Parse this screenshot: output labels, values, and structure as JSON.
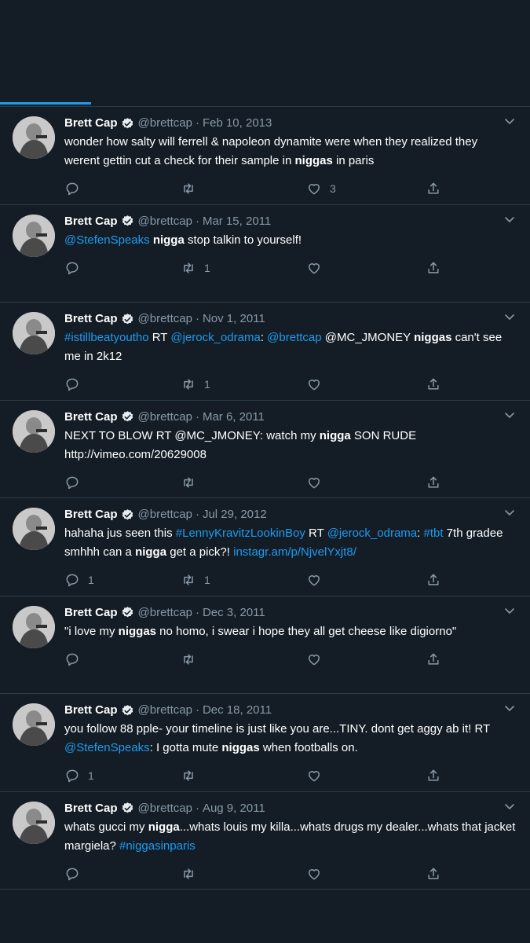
{
  "accent": "#1d9bf0",
  "background": "#141d26",
  "tweets": [
    {
      "name": "Brett Cap",
      "handle": "@brettcap",
      "date": "Feb 10, 2013",
      "parts": [
        {
          "t": "wonder how salty will ferrell & napoleon dynamite were when they realized they werent gettin cut a check for their sample in ",
          "s": "n"
        },
        {
          "t": "niggas",
          "s": "b"
        },
        {
          "t": " in paris",
          "s": "n"
        }
      ],
      "replies": "",
      "retweets": "",
      "likes": "3"
    },
    {
      "name": "Brett Cap",
      "handle": "@brettcap",
      "date": "Mar 15, 2011",
      "parts": [
        {
          "t": "@StefenSpeaks",
          "s": "l"
        },
        {
          "t": " ",
          "s": "n"
        },
        {
          "t": "nigga",
          "s": "b"
        },
        {
          "t": " stop talkin to yourself!",
          "s": "n"
        }
      ],
      "replies": "",
      "retweets": "1",
      "likes": ""
    },
    {
      "name": "Brett Cap",
      "handle": "@brettcap",
      "date": "Nov 1, 2011",
      "parts": [
        {
          "t": "#istillbeatyoutho",
          "s": "l"
        },
        {
          "t": " RT ",
          "s": "n"
        },
        {
          "t": "@jerock_odrama",
          "s": "l"
        },
        {
          "t": ": ",
          "s": "n"
        },
        {
          "t": "@brettcap",
          "s": "l"
        },
        {
          "t": " @MC_JMONEY ",
          "s": "n"
        },
        {
          "t": "niggas",
          "s": "b"
        },
        {
          "t": " can't see me in 2k12",
          "s": "n"
        }
      ],
      "replies": "",
      "retweets": "1",
      "likes": ""
    },
    {
      "name": "Brett Cap",
      "handle": "@brettcap",
      "date": "Mar 6, 2011",
      "parts": [
        {
          "t": "NEXT TO BLOW RT @MC_JMONEY: watch my ",
          "s": "n"
        },
        {
          "t": "nigga",
          "s": "b"
        },
        {
          "t": " SON RUDE http://vimeo.com/20629008",
          "s": "n"
        }
      ],
      "replies": "",
      "retweets": "",
      "likes": ""
    },
    {
      "name": "Brett Cap",
      "handle": "@brettcap",
      "date": "Jul 29, 2012",
      "parts": [
        {
          "t": "hahaha jus seen this ",
          "s": "n"
        },
        {
          "t": "#LennyKravitzLookinBoy",
          "s": "l"
        },
        {
          "t": " RT ",
          "s": "n"
        },
        {
          "t": "@jerock_odrama",
          "s": "l"
        },
        {
          "t": ": ",
          "s": "n"
        },
        {
          "t": "#tbt",
          "s": "l"
        },
        {
          "t": " 7th gradee smhhh can a ",
          "s": "n"
        },
        {
          "t": "nigga",
          "s": "b"
        },
        {
          "t": " get a pick?! ",
          "s": "n"
        },
        {
          "t": "instagr.am/p/NjvelYxjt8/",
          "s": "l"
        }
      ],
      "replies": "1",
      "retweets": "1",
      "likes": ""
    },
    {
      "name": "Brett Cap",
      "handle": "@brettcap",
      "date": "Dec 3, 2011",
      "parts": [
        {
          "t": "\"i love my ",
          "s": "n"
        },
        {
          "t": "niggas",
          "s": "b"
        },
        {
          "t": " no homo, i swear i hope they all get cheese like digiorno\"",
          "s": "n"
        }
      ],
      "replies": "",
      "retweets": "",
      "likes": ""
    },
    {
      "name": "Brett Cap",
      "handle": "@brettcap",
      "date": "Dec 18, 2011",
      "parts": [
        {
          "t": "you follow 88 pple- your timeline is just like you are...TINY. dont get aggy ab it! RT ",
          "s": "n"
        },
        {
          "t": "@StefenSpeaks",
          "s": "l"
        },
        {
          "t": ": I gotta mute ",
          "s": "n"
        },
        {
          "t": "niggas",
          "s": "b"
        },
        {
          "t": " when footballs on.",
          "s": "n"
        }
      ],
      "replies": "1",
      "retweets": "",
      "likes": ""
    },
    {
      "name": "Brett Cap",
      "handle": "@brettcap",
      "date": "Aug 9, 2011",
      "parts": [
        {
          "t": "whats gucci my ",
          "s": "n"
        },
        {
          "t": "nigga",
          "s": "b"
        },
        {
          "t": "...whats louis my killa...whats drugs my dealer...whats that jacket margiela? ",
          "s": "n"
        },
        {
          "t": "#niggasinparis",
          "s": "l"
        }
      ],
      "replies": "",
      "retweets": "",
      "likes": ""
    }
  ]
}
